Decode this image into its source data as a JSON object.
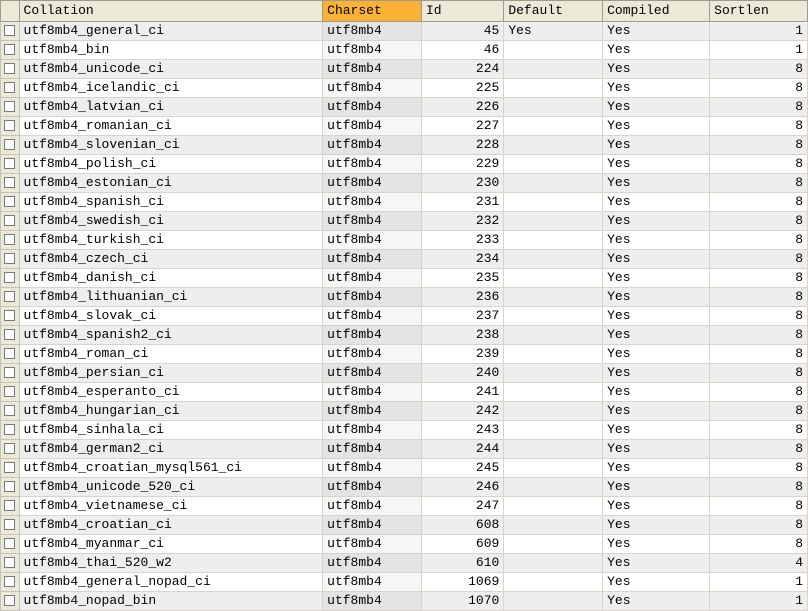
{
  "columns": [
    {
      "key": "collation",
      "label": "Collation",
      "sorted": false,
      "numeric": false
    },
    {
      "key": "charset",
      "label": "Charset",
      "sorted": true,
      "numeric": false
    },
    {
      "key": "id",
      "label": "Id",
      "sorted": false,
      "numeric": true
    },
    {
      "key": "default",
      "label": "Default",
      "sorted": false,
      "numeric": false
    },
    {
      "key": "compiled",
      "label": "Compiled",
      "sorted": false,
      "numeric": false
    },
    {
      "key": "sortlen",
      "label": "Sortlen",
      "sorted": false,
      "numeric": true
    }
  ],
  "rows": [
    {
      "collation": "utf8mb4_general_ci",
      "charset": "utf8mb4",
      "id": 45,
      "default": "Yes",
      "compiled": "Yes",
      "sortlen": 1
    },
    {
      "collation": "utf8mb4_bin",
      "charset": "utf8mb4",
      "id": 46,
      "default": "",
      "compiled": "Yes",
      "sortlen": 1
    },
    {
      "collation": "utf8mb4_unicode_ci",
      "charset": "utf8mb4",
      "id": 224,
      "default": "",
      "compiled": "Yes",
      "sortlen": 8
    },
    {
      "collation": "utf8mb4_icelandic_ci",
      "charset": "utf8mb4",
      "id": 225,
      "default": "",
      "compiled": "Yes",
      "sortlen": 8
    },
    {
      "collation": "utf8mb4_latvian_ci",
      "charset": "utf8mb4",
      "id": 226,
      "default": "",
      "compiled": "Yes",
      "sortlen": 8
    },
    {
      "collation": "utf8mb4_romanian_ci",
      "charset": "utf8mb4",
      "id": 227,
      "default": "",
      "compiled": "Yes",
      "sortlen": 8
    },
    {
      "collation": "utf8mb4_slovenian_ci",
      "charset": "utf8mb4",
      "id": 228,
      "default": "",
      "compiled": "Yes",
      "sortlen": 8
    },
    {
      "collation": "utf8mb4_polish_ci",
      "charset": "utf8mb4",
      "id": 229,
      "default": "",
      "compiled": "Yes",
      "sortlen": 8
    },
    {
      "collation": "utf8mb4_estonian_ci",
      "charset": "utf8mb4",
      "id": 230,
      "default": "",
      "compiled": "Yes",
      "sortlen": 8
    },
    {
      "collation": "utf8mb4_spanish_ci",
      "charset": "utf8mb4",
      "id": 231,
      "default": "",
      "compiled": "Yes",
      "sortlen": 8
    },
    {
      "collation": "utf8mb4_swedish_ci",
      "charset": "utf8mb4",
      "id": 232,
      "default": "",
      "compiled": "Yes",
      "sortlen": 8
    },
    {
      "collation": "utf8mb4_turkish_ci",
      "charset": "utf8mb4",
      "id": 233,
      "default": "",
      "compiled": "Yes",
      "sortlen": 8
    },
    {
      "collation": "utf8mb4_czech_ci",
      "charset": "utf8mb4",
      "id": 234,
      "default": "",
      "compiled": "Yes",
      "sortlen": 8
    },
    {
      "collation": "utf8mb4_danish_ci",
      "charset": "utf8mb4",
      "id": 235,
      "default": "",
      "compiled": "Yes",
      "sortlen": 8
    },
    {
      "collation": "utf8mb4_lithuanian_ci",
      "charset": "utf8mb4",
      "id": 236,
      "default": "",
      "compiled": "Yes",
      "sortlen": 8
    },
    {
      "collation": "utf8mb4_slovak_ci",
      "charset": "utf8mb4",
      "id": 237,
      "default": "",
      "compiled": "Yes",
      "sortlen": 8
    },
    {
      "collation": "utf8mb4_spanish2_ci",
      "charset": "utf8mb4",
      "id": 238,
      "default": "",
      "compiled": "Yes",
      "sortlen": 8
    },
    {
      "collation": "utf8mb4_roman_ci",
      "charset": "utf8mb4",
      "id": 239,
      "default": "",
      "compiled": "Yes",
      "sortlen": 8
    },
    {
      "collation": "utf8mb4_persian_ci",
      "charset": "utf8mb4",
      "id": 240,
      "default": "",
      "compiled": "Yes",
      "sortlen": 8
    },
    {
      "collation": "utf8mb4_esperanto_ci",
      "charset": "utf8mb4",
      "id": 241,
      "default": "",
      "compiled": "Yes",
      "sortlen": 8
    },
    {
      "collation": "utf8mb4_hungarian_ci",
      "charset": "utf8mb4",
      "id": 242,
      "default": "",
      "compiled": "Yes",
      "sortlen": 8
    },
    {
      "collation": "utf8mb4_sinhala_ci",
      "charset": "utf8mb4",
      "id": 243,
      "default": "",
      "compiled": "Yes",
      "sortlen": 8
    },
    {
      "collation": "utf8mb4_german2_ci",
      "charset": "utf8mb4",
      "id": 244,
      "default": "",
      "compiled": "Yes",
      "sortlen": 8
    },
    {
      "collation": "utf8mb4_croatian_mysql561_ci",
      "charset": "utf8mb4",
      "id": 245,
      "default": "",
      "compiled": "Yes",
      "sortlen": 8
    },
    {
      "collation": "utf8mb4_unicode_520_ci",
      "charset": "utf8mb4",
      "id": 246,
      "default": "",
      "compiled": "Yes",
      "sortlen": 8
    },
    {
      "collation": "utf8mb4_vietnamese_ci",
      "charset": "utf8mb4",
      "id": 247,
      "default": "",
      "compiled": "Yes",
      "sortlen": 8
    },
    {
      "collation": "utf8mb4_croatian_ci",
      "charset": "utf8mb4",
      "id": 608,
      "default": "",
      "compiled": "Yes",
      "sortlen": 8
    },
    {
      "collation": "utf8mb4_myanmar_ci",
      "charset": "utf8mb4",
      "id": 609,
      "default": "",
      "compiled": "Yes",
      "sortlen": 8
    },
    {
      "collation": "utf8mb4_thai_520_w2",
      "charset": "utf8mb4",
      "id": 610,
      "default": "",
      "compiled": "Yes",
      "sortlen": 4
    },
    {
      "collation": "utf8mb4_general_nopad_ci",
      "charset": "utf8mb4",
      "id": 1069,
      "default": "",
      "compiled": "Yes",
      "sortlen": 1
    },
    {
      "collation": "utf8mb4_nopad_bin",
      "charset": "utf8mb4",
      "id": 1070,
      "default": "",
      "compiled": "Yes",
      "sortlen": 1
    }
  ]
}
